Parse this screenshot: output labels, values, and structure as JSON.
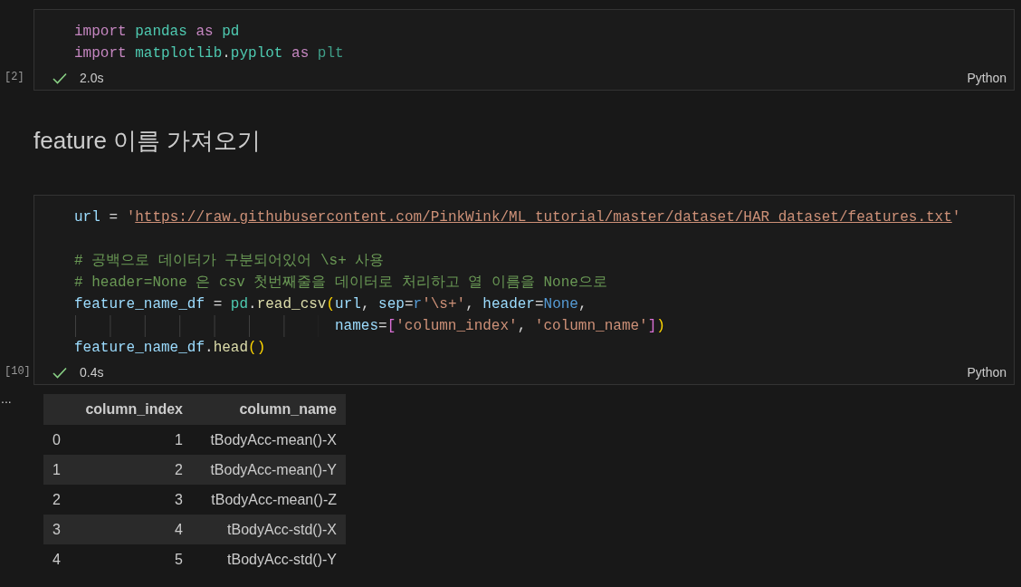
{
  "cells": [
    {
      "kind": "code",
      "execution_count": "[2]",
      "succeeded": true,
      "duration": "2.0s",
      "language": "Python",
      "lines": [
        {
          "tokens": [
            {
              "kind": "keyword",
              "text": "import"
            },
            {
              "kind": "module",
              "text": " pandas"
            },
            {
              "kind": "keyword",
              "text": " as"
            },
            {
              "kind": "module",
              "text": " pd"
            }
          ]
        },
        {
          "tokens": [
            {
              "kind": "keyword",
              "text": "import"
            },
            {
              "kind": "module",
              "text": " matplotlib"
            },
            {
              "kind": "plain",
              "text": "."
            },
            {
              "kind": "module",
              "text": "pyplot"
            },
            {
              "kind": "keyword",
              "text": " as"
            },
            {
              "kind": "alias",
              "text": " plt"
            }
          ]
        }
      ]
    },
    {
      "kind": "markdown",
      "heading": "feature 이름 가져오기"
    },
    {
      "kind": "code",
      "execution_count": "[10]",
      "succeeded": true,
      "duration": "0.4s",
      "language": "Python",
      "lines": [
        {
          "tokens": [
            {
              "kind": "variable",
              "text": "url"
            },
            {
              "kind": "plain",
              "text": " = "
            },
            {
              "kind": "string",
              "text": "'"
            },
            {
              "kind": "link",
              "text": "https://raw.githubusercontent.com/PinkWink/ML_tutorial/master/dataset/HAR_dataset/features.txt"
            },
            {
              "kind": "string",
              "text": "'"
            }
          ]
        },
        {
          "blank": true
        },
        {
          "tokens": [
            {
              "kind": "comment",
              "text": "# 공백으로 데이터가 구분되어있어 \\s+ 사용"
            }
          ]
        },
        {
          "tokens": [
            {
              "kind": "comment",
              "text": "# header=None 은 csv 첫번째줄을 데이터로 처리하고 열 이름을 None으로"
            }
          ]
        },
        {
          "tokens": [
            {
              "kind": "variable",
              "text": "feature_name_df"
            },
            {
              "kind": "plain",
              "text": " = "
            },
            {
              "kind": "module",
              "text": "pd"
            },
            {
              "kind": "plain",
              "text": "."
            },
            {
              "kind": "function",
              "text": "read_csv"
            },
            {
              "kind": "bracket1",
              "text": "("
            },
            {
              "kind": "variable",
              "text": "url"
            },
            {
              "kind": "plain",
              "text": ", "
            },
            {
              "kind": "variable",
              "text": "sep"
            },
            {
              "kind": "plain",
              "text": "="
            },
            {
              "kind": "constant",
              "text": "r"
            },
            {
              "kind": "string",
              "text": "'\\s+'"
            },
            {
              "kind": "plain",
              "text": ", "
            },
            {
              "kind": "variable",
              "text": "header"
            },
            {
              "kind": "plain",
              "text": "="
            },
            {
              "kind": "constant",
              "text": "None"
            },
            {
              "kind": "plain",
              "text": ","
            }
          ]
        },
        {
          "indent_guides": true,
          "tokens": [
            {
              "kind": "variable",
              "text": "names"
            },
            {
              "kind": "plain",
              "text": "="
            },
            {
              "kind": "bracket2",
              "text": "["
            },
            {
              "kind": "string",
              "text": "'column_index'"
            },
            {
              "kind": "plain",
              "text": ", "
            },
            {
              "kind": "string",
              "text": "'column_name'"
            },
            {
              "kind": "bracket2",
              "text": "]"
            },
            {
              "kind": "bracket1",
              "text": ")"
            }
          ]
        },
        {
          "tokens": [
            {
              "kind": "variable",
              "text": "feature_name_df"
            },
            {
              "kind": "plain",
              "text": "."
            },
            {
              "kind": "function",
              "text": "head"
            },
            {
              "kind": "bracket1",
              "text": "()"
            }
          ]
        }
      ],
      "output": {
        "more": "...",
        "table": {
          "columns": [
            "column_index",
            "column_name"
          ],
          "rows": [
            {
              "index": "0",
              "cells": [
                "1",
                "tBodyAcc-mean()-X"
              ]
            },
            {
              "index": "1",
              "cells": [
                "2",
                "tBodyAcc-mean()-Y"
              ]
            },
            {
              "index": "2",
              "cells": [
                "3",
                "tBodyAcc-mean()-Z"
              ]
            },
            {
              "index": "3",
              "cells": [
                "4",
                "tBodyAcc-std()-X"
              ]
            },
            {
              "index": "4",
              "cells": [
                "5",
                "tBodyAcc-std()-Y"
              ]
            }
          ]
        }
      }
    }
  ]
}
